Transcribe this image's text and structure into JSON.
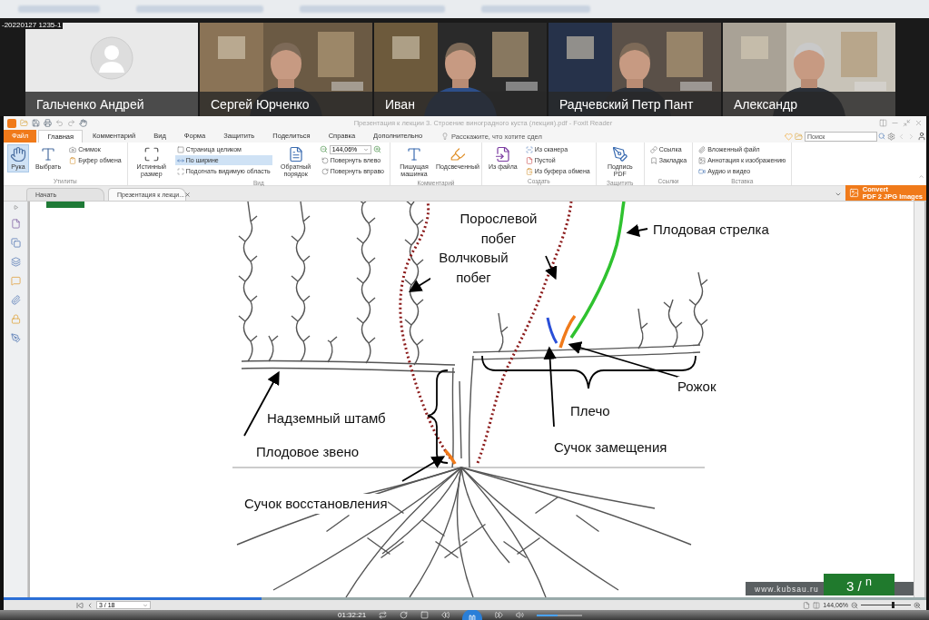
{
  "recording_label": "-20220127 1235-1",
  "participants": [
    {
      "name": "Гальченко Андрей",
      "kind": "avatar"
    },
    {
      "name": "Сергей Юрченко",
      "kind": "video"
    },
    {
      "name": "Иван",
      "kind": "video"
    },
    {
      "name": "Радчевский Петр Пант",
      "kind": "video"
    },
    {
      "name": "Александр",
      "kind": "video"
    }
  ],
  "reader": {
    "title": "Презентация к лекции 3. Строение виноградного куста (лекция).pdf - Foxit Reader",
    "menu_tabs": [
      {
        "label": "Файл",
        "kind": "file",
        "selected": false
      },
      {
        "label": "Главная",
        "kind": "tab",
        "selected": true
      },
      {
        "label": "Комментарий",
        "kind": "tab",
        "selected": false
      },
      {
        "label": "Вид",
        "kind": "tab",
        "selected": false
      },
      {
        "label": "Форма",
        "kind": "tab",
        "selected": false
      },
      {
        "label": "Защитить",
        "kind": "tab",
        "selected": false
      },
      {
        "label": "Поделиться",
        "kind": "tab",
        "selected": false
      },
      {
        "label": "Справка",
        "kind": "tab",
        "selected": false
      },
      {
        "label": "Дополнительно",
        "kind": "tab",
        "selected": false
      }
    ],
    "tell_me": "Расскажите, что хотите сдел",
    "search": {
      "placeholder": "Поиск"
    },
    "ribbon": [
      {
        "label": "Утилиты",
        "items": [
          {
            "kind": "large",
            "label": "Рука",
            "selected": true
          },
          {
            "kind": "large",
            "label": "Выбрать",
            "selected": false
          },
          {
            "kind": "stack",
            "items": [
              {
                "kind": "button",
                "label": "Снимок",
                "selected": false
              },
              {
                "kind": "button",
                "label": "Буфер обмена",
                "selected": false
              }
            ]
          }
        ]
      },
      {
        "label": "Вид",
        "items": [
          {
            "kind": "large",
            "label": "Истинный размер",
            "selected": false
          },
          {
            "kind": "stack",
            "items": [
              {
                "kind": "button",
                "label": "Страница целиком",
                "selected": false
              },
              {
                "kind": "button",
                "label": "По ширине",
                "selected": true
              },
              {
                "kind": "button",
                "label": "Подогнать видимую область",
                "selected": false
              }
            ]
          },
          {
            "kind": "large",
            "label": "Обратный порядок",
            "selected": false
          },
          {
            "kind": "stack",
            "items": [
              {
                "kind": "field",
                "value": "144,06%"
              },
              {
                "kind": "button",
                "label": "Повернуть влево",
                "selected": false
              },
              {
                "kind": "button",
                "label": "Повернуть вправо",
                "selected": false
              }
            ]
          }
        ]
      },
      {
        "label": "Комментарий",
        "items": [
          {
            "kind": "large",
            "label": "Пишущая машинка",
            "selected": false
          },
          {
            "kind": "large",
            "label": "Подсвеченный",
            "selected": false
          }
        ]
      },
      {
        "label": "Создать",
        "items": [
          {
            "kind": "large",
            "label": "Из файла",
            "selected": false
          },
          {
            "kind": "stack",
            "items": [
              {
                "kind": "button",
                "label": "Из сканера",
                "selected": false
              },
              {
                "kind": "button",
                "label": "Пустой",
                "selected": false
              },
              {
                "kind": "button",
                "label": "Из буфера обмена",
                "selected": false
              }
            ]
          }
        ]
      },
      {
        "label": "Защитить",
        "items": [
          {
            "kind": "large",
            "label": "Подпись PDF",
            "selected": false
          }
        ]
      },
      {
        "label": "Ссылки",
        "items": [
          {
            "kind": "stack",
            "items": [
              {
                "kind": "button",
                "label": "Ссылка",
                "selected": false
              },
              {
                "kind": "button",
                "label": "Закладка",
                "selected": false
              }
            ]
          }
        ]
      },
      {
        "label": "Вставка",
        "items": [
          {
            "kind": "stack",
            "items": [
              {
                "kind": "button",
                "label": "Вложенный файл",
                "selected": false
              },
              {
                "kind": "button",
                "label": "Аннотация к изображению",
                "selected": false
              },
              {
                "kind": "button",
                "label": "Аудио и видео",
                "selected": false
              }
            ]
          }
        ]
      }
    ],
    "doc_tabs": [
      {
        "label": "Начать",
        "selected": false,
        "closable": false
      },
      {
        "label": "Презентация к лекци...",
        "selected": true,
        "closable": true
      }
    ],
    "convert_button": {
      "line_1": "Convert",
      "line_2": "PDF 2 JPG Images"
    },
    "slide": {
      "labels": [
        "Порослевой побег",
        "Волчковый побег",
        "Плодовая стрелка",
        "Рожок",
        "Плечо",
        "Надземный штамб",
        "Плодовое звено",
        "Сучок замещения",
        "Сучок восстановления"
      ],
      "site": "www.kubsau.ru",
      "page_badge": "3 / $^{n}$"
    },
    "status_bar": {
      "page": "3 / 18",
      "zoom": "144,06%",
      "zoom_slider": {
        "level": 0.62
      }
    }
  },
  "player": {
    "time": "01:32:21",
    "progress": {
      "level": 0.28
    },
    "volume": {
      "level": 0.45
    }
  }
}
